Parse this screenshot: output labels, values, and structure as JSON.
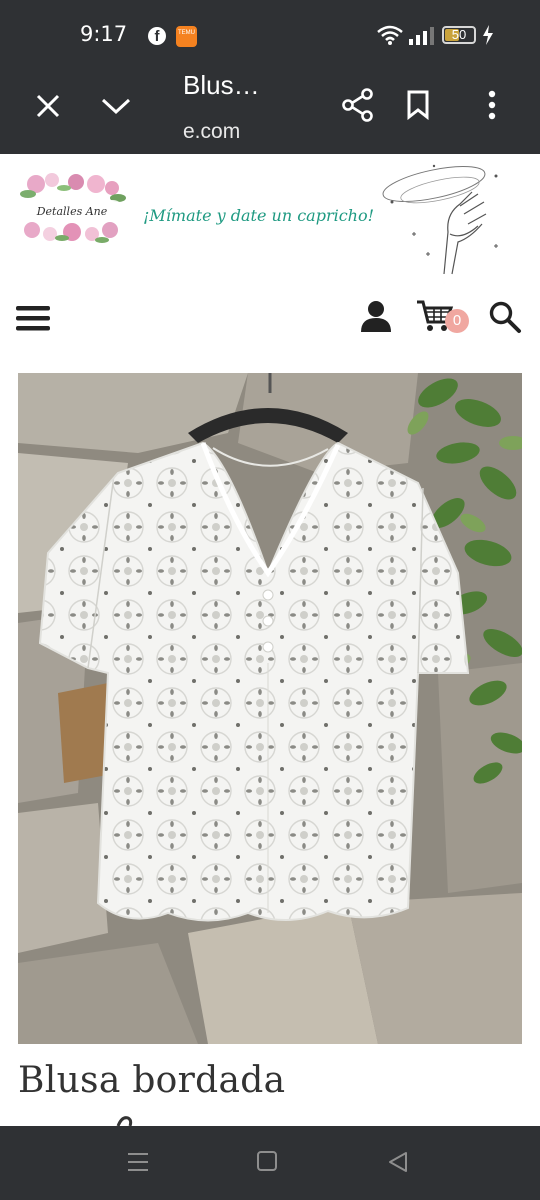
{
  "status_bar": {
    "time": "9:17",
    "battery": "50",
    "battery_level": 0.5,
    "temu_label": "TEMU"
  },
  "toolbar": {
    "title": "Blus…",
    "url": "e.com"
  },
  "site": {
    "logo_text": "Detalles Ane",
    "slogan": "¡Mímate y date un capricho!",
    "cart_count": "0"
  },
  "product": {
    "title": "Blusa bordada"
  },
  "icons": {
    "close": "close-icon",
    "chevron": "chevron-down-icon",
    "share": "share-icon",
    "bookmark": "bookmark-icon",
    "more": "more-vert-icon",
    "menu": "hamburger-menu-icon",
    "account": "account-icon",
    "cart": "cart-icon",
    "search": "search-icon"
  },
  "colors": {
    "chrome": "#2f3134",
    "slogan": "#1f9a82",
    "badge": "#f0a7a0"
  }
}
